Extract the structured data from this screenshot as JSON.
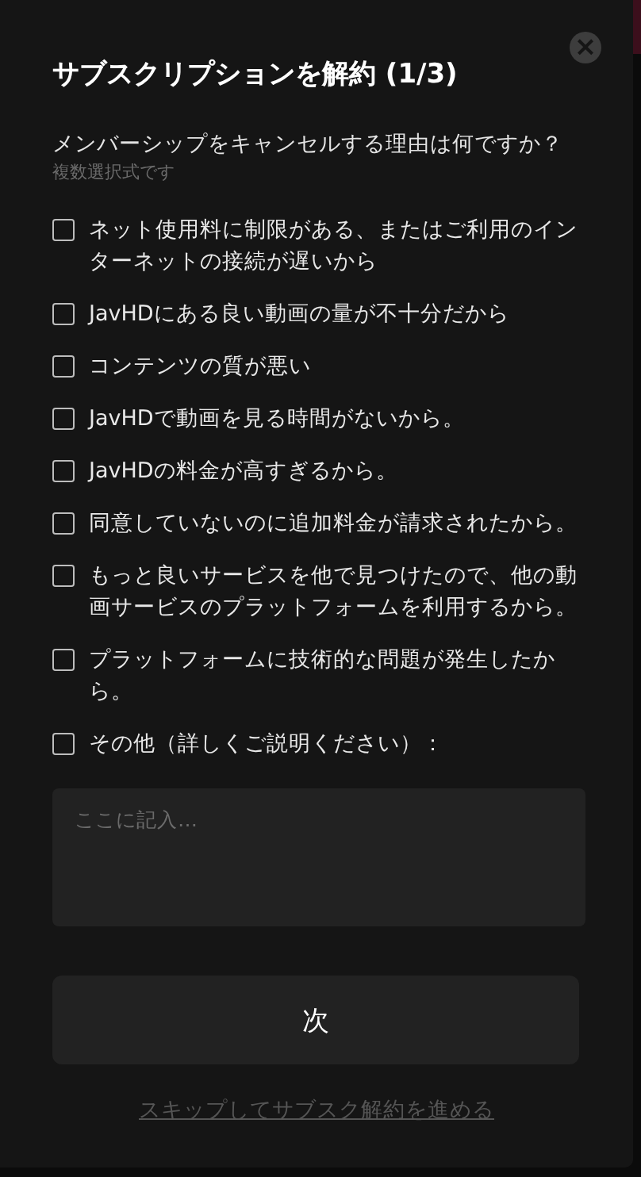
{
  "dialog": {
    "title": "サブスクリプションを解約 (1/3)",
    "close_icon": "×",
    "question": "メンバーシップをキャンセルする理由は何ですか？",
    "hint": "複数選択式です",
    "options": [
      {
        "label": "ネット使用料に制限がある、またはご利用のインターネットの接続が遅いから",
        "checked": false
      },
      {
        "label": "JavHDにある良い動画の量が不十分だから",
        "checked": false
      },
      {
        "label": "コンテンツの質が悪い",
        "checked": false
      },
      {
        "label": "JavHDで動画を見る時間がないから。",
        "checked": false
      },
      {
        "label": "JavHDの料金が高すぎるから。",
        "checked": false
      },
      {
        "label": "同意していないのに追加料金が請求されたから。",
        "checked": false
      },
      {
        "label": "もっと良いサービスを他で見つけたので、他の動画サービスのプラットフォームを利用するから。",
        "checked": false
      },
      {
        "label": "プラットフォームに技術的な問題が発生したから。",
        "checked": false
      },
      {
        "label": "その他（詳しくご説明ください）：",
        "checked": false
      }
    ],
    "details": {
      "placeholder": "ここに記入…"
    },
    "next_button": "次",
    "skip_link": "スキップしてサブスク解約を進める"
  }
}
